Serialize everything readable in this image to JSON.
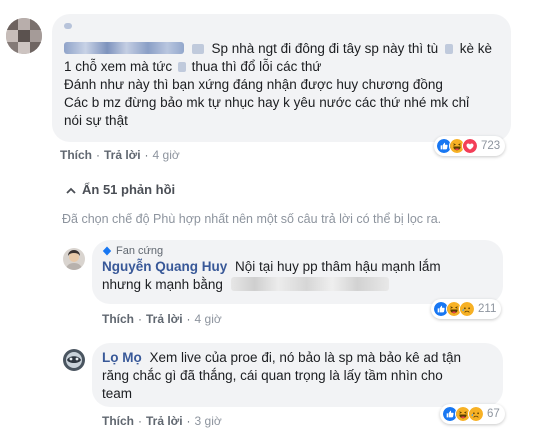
{
  "comments": [
    {
      "name_visible": "",
      "text_line1": "Sp nhà ngt đi đông đi tây sp này thì tù",
      "text_line1b": "kè kè",
      "text_line2a": "1 chỗ xem mà tức",
      "text_line2b": "thua thì đổ lỗi các thứ",
      "text_line3": "Đánh như này thì bạn xứng đáng nhận được huy chương đồng",
      "text_line4": "Các b mz đừng bảo mk tự nhục hay k yêu nước các thứ nhé mk chỉ",
      "text_line5": "nói sự thật",
      "actions": {
        "like": "Thích",
        "reply": "Trả lời",
        "time": "4 giờ"
      },
      "reactions": {
        "icons": [
          "like-icon",
          "haha-icon",
          "love-icon"
        ],
        "count": "723"
      }
    }
  ],
  "replies_toggle": {
    "arrow": "⌃",
    "label": "Ẩn 51 phản hồi"
  },
  "filter_notice": "Đã chọn chế độ Phù hợp nhất nên một số câu trả lời có thể bị lọc ra.",
  "replies": [
    {
      "badge": "Fan cứng",
      "author": "Nguyễn Quang Huy",
      "text_line1": "Nội tại huy pp thâm hậu mạnh lắm",
      "text_line2": "nhưng k mạnh bằng",
      "actions": {
        "like": "Thích",
        "reply": "Trả lời",
        "time": "4 giờ"
      },
      "reactions": {
        "icons": [
          "like-icon",
          "haha-icon",
          "sad-icon"
        ],
        "count": "211"
      }
    },
    {
      "author": "Lọ Mọ",
      "text_line1": "Xem live của proe đi, nó bảo là sp mà bảo kê ad tận",
      "text_line2": "răng chắc gì đã thắng, cái quan trọng là lấy tầm nhìn cho",
      "text_line3": "team",
      "actions": {
        "like": "Thích",
        "reply": "Trả lời",
        "time": "3 giờ"
      },
      "reactions": {
        "icons": [
          "like-icon",
          "haha-icon",
          "sad-icon"
        ],
        "count": "67"
      }
    }
  ],
  "colors": {
    "bubble": "#f2f3f5",
    "author_link": "#385898",
    "like": "#1877f2",
    "love": "#f33e58",
    "haha": "#f7b125"
  }
}
